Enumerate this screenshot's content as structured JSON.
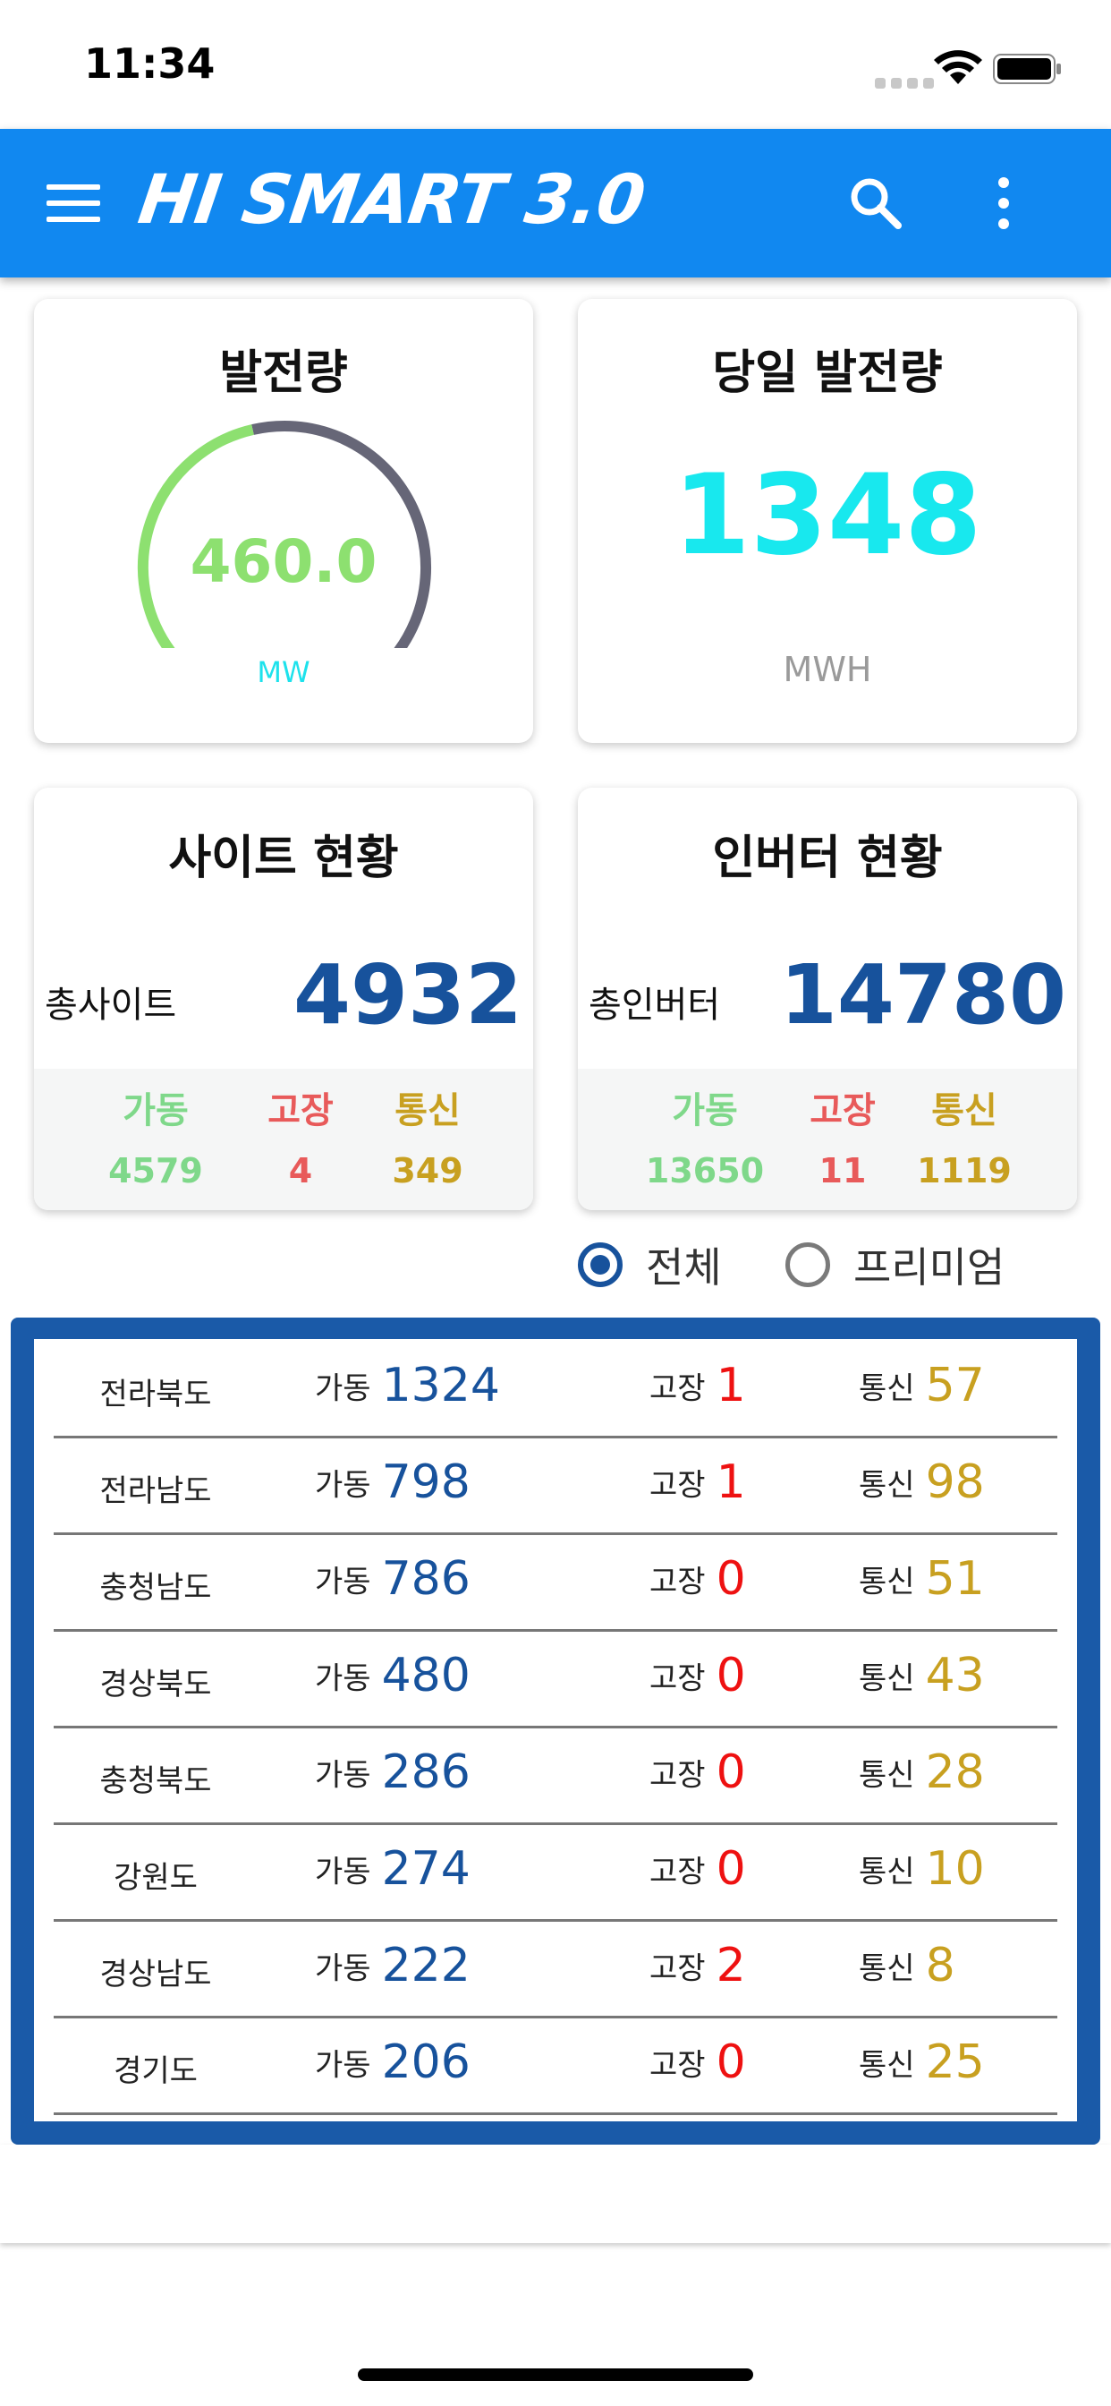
{
  "status": {
    "time": "11:34"
  },
  "header": {
    "logo": "HI SMART 3.0"
  },
  "power": {
    "title": "발전량",
    "value": "460.0",
    "unit": "MW",
    "gauge_fraction": 0.45,
    "colors": {
      "fill": "#8de070",
      "track": "#666677"
    }
  },
  "daily": {
    "title": "당일 발전량",
    "value": "1348",
    "unit": "MWH"
  },
  "site": {
    "title": "사이트 현황",
    "total_label": "총사이트",
    "total": "4932",
    "stats": [
      {
        "label": "가동",
        "value": "4579"
      },
      {
        "label": "고장",
        "value": "4"
      },
      {
        "label": "통신",
        "value": "349"
      }
    ]
  },
  "inverter": {
    "title": "인버터 현황",
    "total_label": "총인버터",
    "total": "14780",
    "stats": [
      {
        "label": "가동",
        "value": "13650"
      },
      {
        "label": "고장",
        "value": "11"
      },
      {
        "label": "통신",
        "value": "1119"
      }
    ]
  },
  "filter": {
    "all": "전체",
    "premium": "프리미엄",
    "selected": "all"
  },
  "labels": {
    "run": "가동",
    "fault": "고장",
    "comm": "통신"
  },
  "regions": [
    {
      "name": "전라북도",
      "run": "1324",
      "fault": "1",
      "comm": "57"
    },
    {
      "name": "전라남도",
      "run": "798",
      "fault": "1",
      "comm": "98"
    },
    {
      "name": "충청남도",
      "run": "786",
      "fault": "0",
      "comm": "51"
    },
    {
      "name": "경상북도",
      "run": "480",
      "fault": "0",
      "comm": "43"
    },
    {
      "name": "충청북도",
      "run": "286",
      "fault": "0",
      "comm": "28"
    },
    {
      "name": "강원도",
      "run": "274",
      "fault": "0",
      "comm": "10"
    },
    {
      "name": "경상남도",
      "run": "222",
      "fault": "2",
      "comm": "8"
    },
    {
      "name": "경기도",
      "run": "206",
      "fault": "0",
      "comm": "25"
    }
  ]
}
